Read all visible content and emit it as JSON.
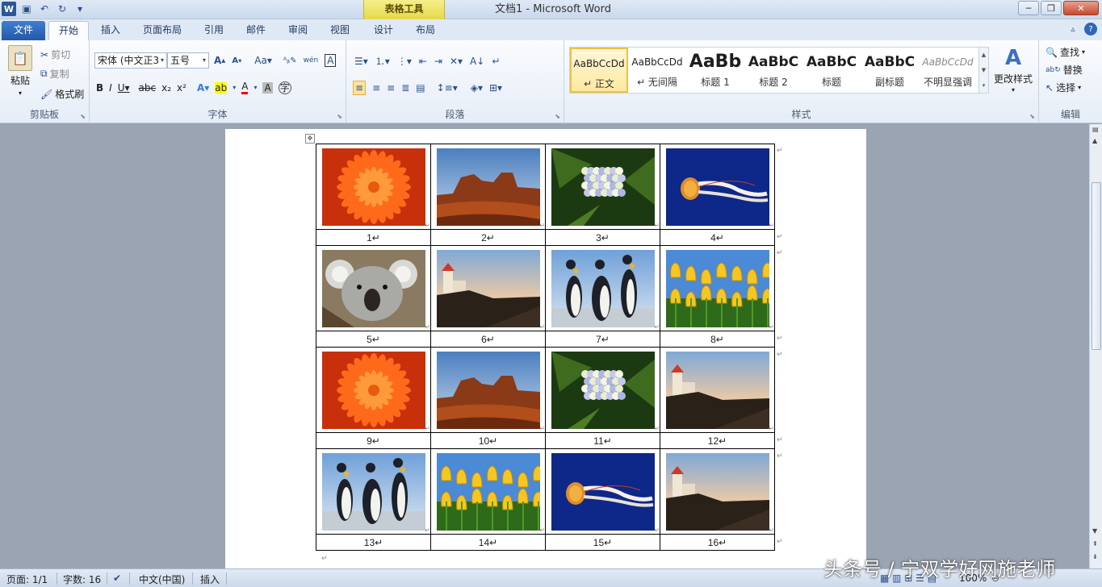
{
  "window": {
    "title": "文档1  -  Microsoft Word",
    "context_tab": "表格工具"
  },
  "tabs": {
    "file": "文件",
    "home": "开始",
    "insert": "插入",
    "layout": "页面布局",
    "references": "引用",
    "mailings": "邮件",
    "review": "审阅",
    "view": "视图",
    "design": "设计",
    "table_layout": "布局"
  },
  "clipboard": {
    "paste": "粘贴",
    "cut": "剪切",
    "copy": "复制",
    "format_painter": "格式刷",
    "label": "剪贴板"
  },
  "font": {
    "name": "宋体 (中文正3",
    "size": "五号",
    "label": "字体"
  },
  "paragraph": {
    "label": "段落"
  },
  "styles": {
    "label": "样式",
    "items": [
      {
        "preview": "AaBbCcDd",
        "name": "↵ 正文"
      },
      {
        "preview": "AaBbCcDd",
        "name": "↵ 无间隔"
      },
      {
        "preview": "AaBb",
        "name": "标题 1"
      },
      {
        "preview": "AaBbC",
        "name": "标题 2"
      },
      {
        "preview": "AaBbC",
        "name": "标题"
      },
      {
        "preview": "AaBbC",
        "name": "副标题"
      },
      {
        "preview": "AaBbCcDd",
        "name": "不明显强调"
      }
    ],
    "change_styles": "更改样式"
  },
  "editing": {
    "find": "查找",
    "replace": "替换",
    "select": "选择",
    "label": "编辑"
  },
  "table": {
    "labels": [
      "1↵",
      "2↵",
      "3↵",
      "4↵",
      "5↵",
      "6↵",
      "7↵",
      "8↵",
      "9↵",
      "10↵",
      "11↵",
      "12↵",
      "13↵",
      "14↵",
      "15↵",
      "16↵"
    ],
    "images": [
      "chrysanthemum",
      "desert",
      "hydrangeas",
      "jellyfish",
      "koala",
      "lighthouse",
      "penguins",
      "tulips",
      "chrysanthemum",
      "desert",
      "hydrangeas",
      "lighthouse",
      "penguins",
      "tulips",
      "jellyfish",
      "lighthouse"
    ]
  },
  "status": {
    "page": "页面: 1/1",
    "words": "字数: 16",
    "language": "中文(中国)",
    "mode": "插入",
    "zoom": "100%"
  },
  "watermark": "头条号 / 宁双学好网施老师",
  "colors": {
    "file_tab": "#2b5ea8",
    "context_tab": "#e8dc5a",
    "workspace": "#9aa4b3"
  }
}
